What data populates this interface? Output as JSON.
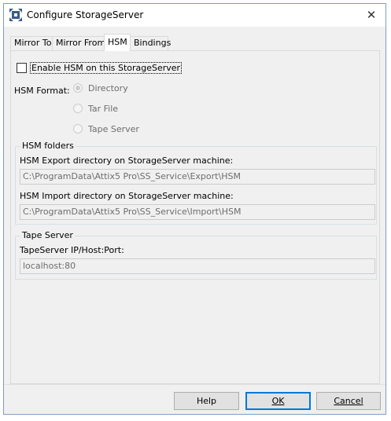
{
  "window": {
    "title": "Configure StorageServer",
    "close_glyph": "✕",
    "icon": "storage-server-icon"
  },
  "tabs": [
    {
      "label": "Mirror To",
      "active": false
    },
    {
      "label": "Mirror From",
      "active": false
    },
    {
      "label": "HSM",
      "active": true
    },
    {
      "label": "Bindings",
      "active": false
    }
  ],
  "hsm": {
    "enable_label": "Enable HSM on this StorageServer",
    "enable_checked": false,
    "format_label": "HSM Format:",
    "format_options": [
      {
        "label": "Directory",
        "selected": true
      },
      {
        "label": "Tar File",
        "selected": false
      },
      {
        "label": "Tape Server",
        "selected": false
      }
    ]
  },
  "hsm_folders": {
    "title": "HSM folders",
    "export_label": "HSM Export directory on StorageServer machine:",
    "export_value": "C:\\ProgramData\\Attix5 Pro\\SS_Service\\Export\\HSM",
    "import_label": "HSM Import directory on StorageServer machine:",
    "import_value": "C:\\ProgramData\\Attix5 Pro\\SS_Service\\Import\\HSM"
  },
  "tape_server": {
    "title": "Tape Server",
    "address_label": "TapeServer IP/Host:Port:",
    "address_value": "localhost:80"
  },
  "buttons": {
    "help": "Help",
    "ok": "OK",
    "cancel": "Cancel"
  },
  "colors": {
    "accent": "#0078d7",
    "dialog_bg": "#f0f0f0"
  }
}
